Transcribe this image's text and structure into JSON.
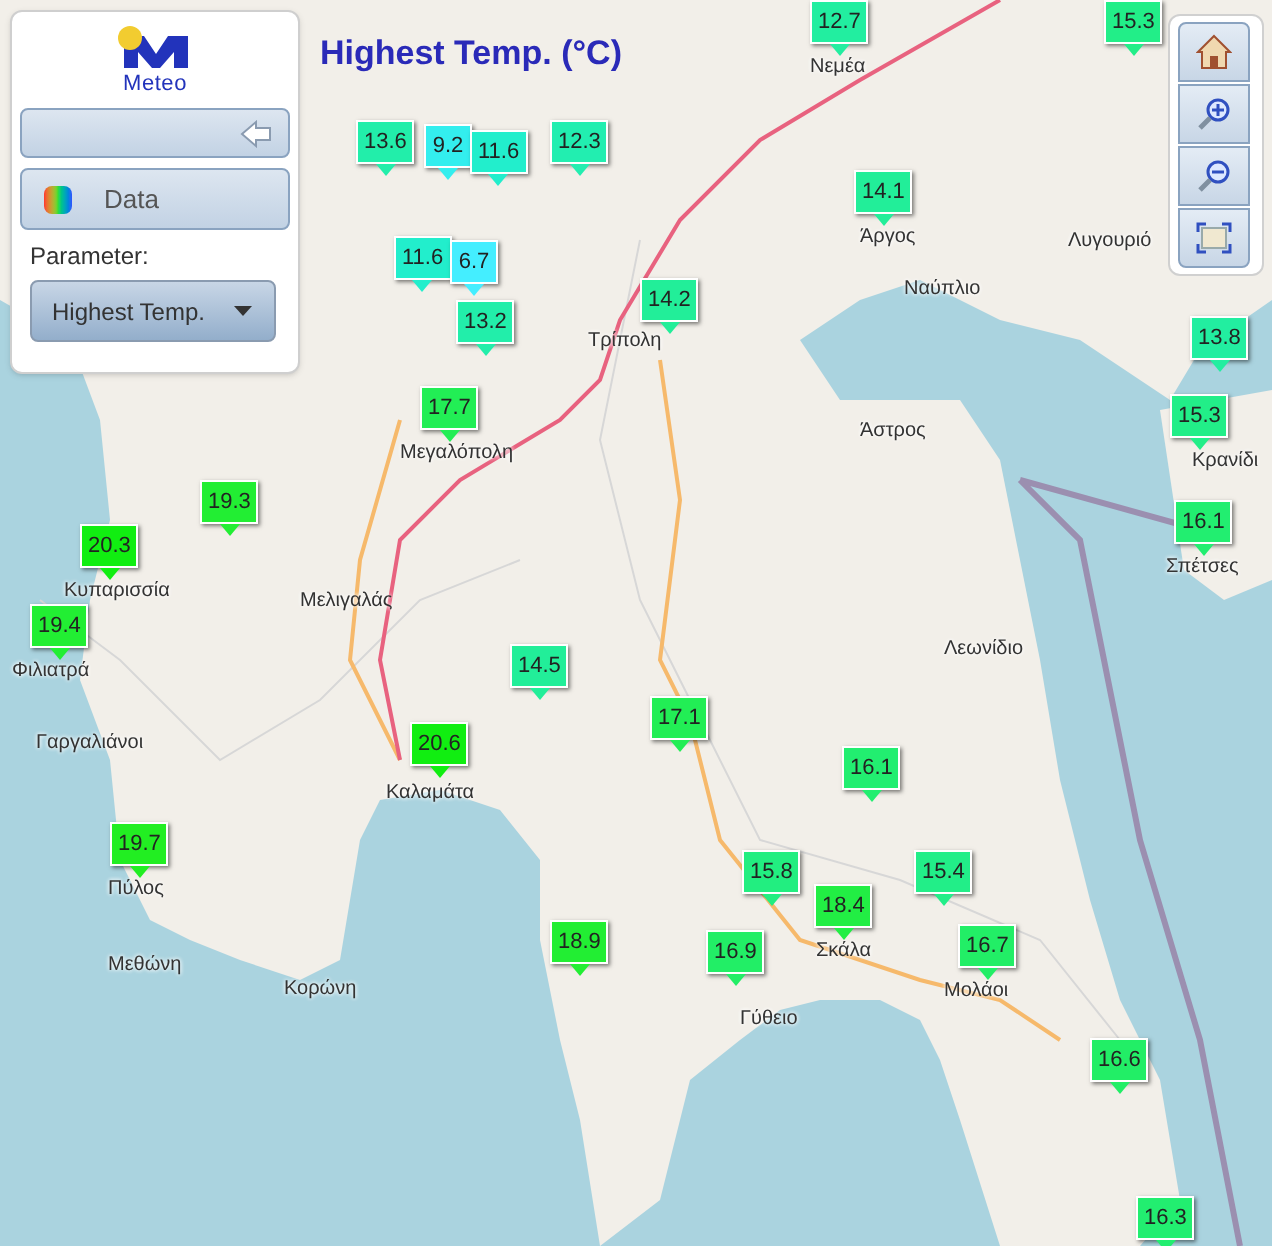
{
  "logo": {
    "text": "Meteo"
  },
  "title": "Highest Temp. (°C)",
  "panel": {
    "data_button": "Data",
    "parameter_label": "Parameter:",
    "parameter_select": "Highest Temp."
  },
  "map_controls": [
    {
      "kind": "home"
    },
    {
      "kind": "zoom_in"
    },
    {
      "kind": "zoom_out"
    },
    {
      "kind": "extent"
    }
  ],
  "places": [
    {
      "name": "Νεμέα"
    },
    {
      "name": "Άργος"
    },
    {
      "name": "Ναύπλιο"
    },
    {
      "name": "Λυγουριό"
    },
    {
      "name": "Τρίπολη"
    },
    {
      "name": "Άστρος"
    },
    {
      "name": "Κρανίδι"
    },
    {
      "name": "Σπέτσες"
    },
    {
      "name": "Μεγαλόπολη"
    },
    {
      "name": "Κυπαρισσία"
    },
    {
      "name": "Μελιγαλάς"
    },
    {
      "name": "Φιλιατρά"
    },
    {
      "name": "Γαργαλιάνοι"
    },
    {
      "name": "Καλαμάτα"
    },
    {
      "name": "Λεωνίδιο"
    },
    {
      "name": "Πύλος"
    },
    {
      "name": "Μεθώνη"
    },
    {
      "name": "Κορώνη"
    },
    {
      "name": "Σκάλα"
    },
    {
      "name": "Γύθειο"
    },
    {
      "name": "Μολάοι"
    }
  ],
  "stations": [
    {
      "value": "12.7",
      "color": "#22eea0"
    },
    {
      "value": "15.3",
      "color": "#22ee88"
    },
    {
      "value": "13.6",
      "color": "#22eeaa"
    },
    {
      "value": "9.2",
      "color": "#33eeee"
    },
    {
      "value": "11.6",
      "color": "#22eecc"
    },
    {
      "value": "12.3",
      "color": "#22eeb0"
    },
    {
      "value": "14.1",
      "color": "#22ee99"
    },
    {
      "value": "11.6",
      "color": "#22eecc"
    },
    {
      "value": "6.7",
      "color": "#44eeff"
    },
    {
      "value": "13.2",
      "color": "#22eeaa"
    },
    {
      "value": "14.2",
      "color": "#22ee99"
    },
    {
      "value": "13.8",
      "color": "#22eea0"
    },
    {
      "value": "17.7",
      "color": "#22ee55"
    },
    {
      "value": "15.3",
      "color": "#22ee88"
    },
    {
      "value": "20.3",
      "color": "#11ee11"
    },
    {
      "value": "19.3",
      "color": "#22ee33"
    },
    {
      "value": "16.1",
      "color": "#22ee70"
    },
    {
      "value": "19.4",
      "color": "#22ee33"
    },
    {
      "value": "14.5",
      "color": "#22ee99"
    },
    {
      "value": "20.6",
      "color": "#11ee11"
    },
    {
      "value": "17.1",
      "color": "#22ee55"
    },
    {
      "value": "16.1",
      "color": "#22ee70"
    },
    {
      "value": "19.7",
      "color": "#22ee22"
    },
    {
      "value": "18.9",
      "color": "#22ee33"
    },
    {
      "value": "16.9",
      "color": "#22ee66"
    },
    {
      "value": "15.8",
      "color": "#22ee80"
    },
    {
      "value": "18.4",
      "color": "#22ee44"
    },
    {
      "value": "15.4",
      "color": "#22ee88"
    },
    {
      "value": "16.7",
      "color": "#22ee66"
    },
    {
      "value": "16.6",
      "color": "#22ee66"
    },
    {
      "value": "16.3",
      "color": "#22ee70"
    }
  ]
}
